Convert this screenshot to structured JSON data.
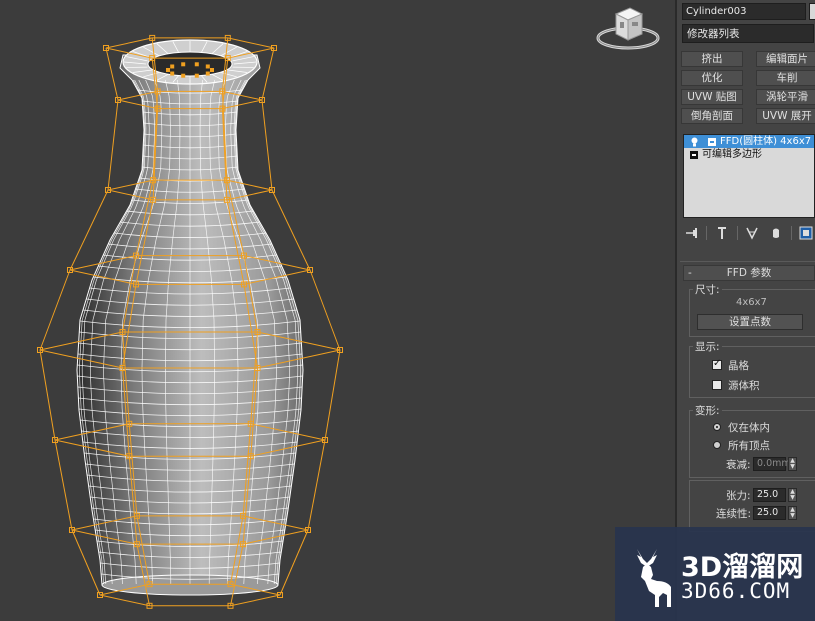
{
  "object_name": "Cylinder003",
  "modifier_list": "修改器列表",
  "modifier_buttons": [
    "挤出",
    "编辑面片",
    "优化",
    "车削",
    "UVW 贴图",
    "涡轮平滑",
    "倒角剖面",
    "UVW 展开"
  ],
  "stack": [
    {
      "label": "FFD(圆柱体) 4x6x7",
      "selected": true
    },
    {
      "label": "可编辑多边形",
      "selected": false
    }
  ],
  "tools": {
    "pin": "pin-stack-icon",
    "show_end": "show-end-result-icon",
    "unique": "make-unique-icon",
    "remove": "remove-modifier-icon",
    "configure": "configure-modifier-sets-icon"
  },
  "ffd": {
    "title": "FFD 参数",
    "dimensions_label": "尺寸:",
    "dimensions_value": "4x6x7",
    "set_points_button": "设置点数",
    "display_label": "显示:",
    "lattice_label": "晶格",
    "lattice_checked": true,
    "source_volume_label": "源体积",
    "source_volume_checked": false,
    "deform_label": "变形:",
    "only_in_volume_label": "仅在体内",
    "only_in_volume_selected": true,
    "all_vertices_label": "所有顶点",
    "all_vertices_selected": false,
    "falloff_label": "衰减:",
    "falloff_value": "0.0mm",
    "tension_label": "张力:",
    "tension_value": "25.0",
    "continuity_label": "连续性:",
    "continuity_value": "25.0"
  },
  "watermark": {
    "title": "3D溜溜网",
    "subtitle": "3D66.COM"
  },
  "colors": {
    "viewport_bg": "#3c3c3c",
    "lattice": "#f0a020",
    "wire": "#ffffff",
    "selection": "#3e8fd6",
    "panel_bg": "#444444"
  }
}
